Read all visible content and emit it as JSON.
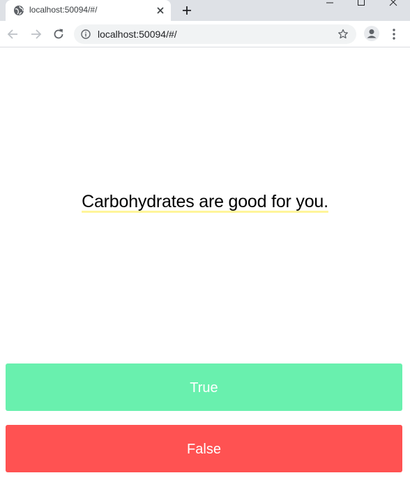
{
  "browser": {
    "tab": {
      "title": "localhost:50094/#/"
    },
    "address_bar": {
      "url": "localhost:50094/#/"
    }
  },
  "quiz": {
    "statement": "Carbohydrates are good for you.",
    "true_label": "True",
    "false_label": "False"
  },
  "colors": {
    "true_button": "#69f0ae",
    "false_button": "#ff5252",
    "underline": "#fff59a"
  }
}
